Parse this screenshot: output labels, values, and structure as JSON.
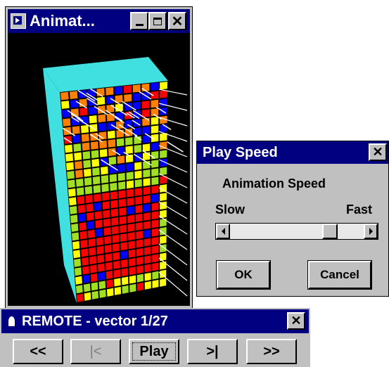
{
  "animation_window": {
    "title": "Animat..."
  },
  "play_speed_dialog": {
    "title": "Play Speed",
    "heading": "Animation Speed",
    "slow_label": "Slow",
    "fast_label": "Fast",
    "slider_value": 0.78,
    "ok_label": "OK",
    "cancel_label": "Cancel"
  },
  "remote": {
    "title": "REMOTE - vector 1/27",
    "buttons": {
      "rewind": "<<",
      "first": "|<",
      "play": "Play",
      "next": ">|",
      "fast_forward": ">>"
    }
  },
  "colors": {
    "titlebar": "#000080",
    "face": "#c0c0c0",
    "cube_top": "#40e0e0",
    "cube_red": "#ff0000",
    "cube_yellow": "#ffff00",
    "cube_green": "#a0e020",
    "cube_blue": "#0000ff",
    "cube_orange": "#ff8000"
  }
}
